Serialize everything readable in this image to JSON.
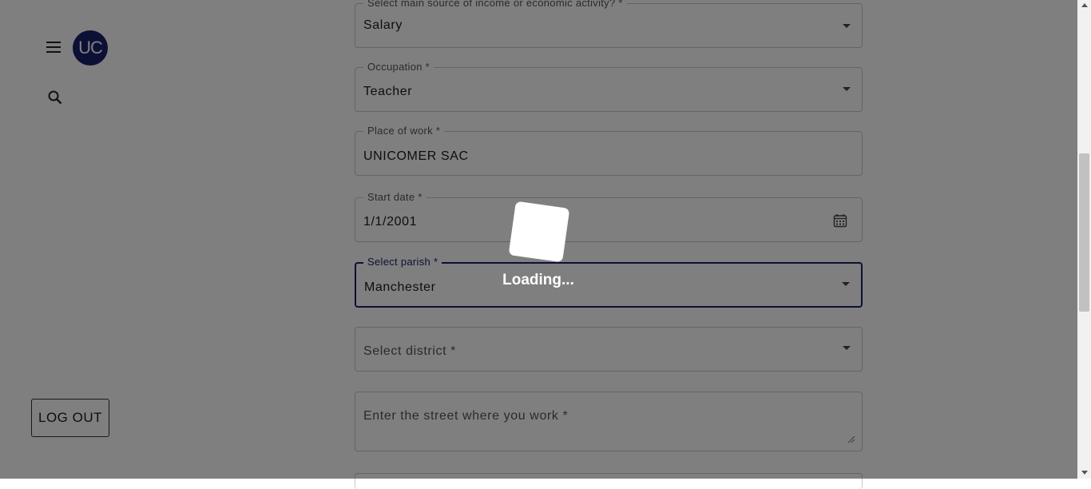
{
  "sidebar": {
    "avatar_initials": "UC",
    "menu_icon": "hamburger-menu-icon",
    "search_icon": "search-icon",
    "logout_label": "LOG OUT"
  },
  "form": {
    "income_source": {
      "label": "Select main source of income or economic activity? *",
      "value": "Salary"
    },
    "occupation": {
      "label": "Occupation *",
      "value": "Teacher"
    },
    "place_of_work": {
      "label": "Place of work *",
      "value": "UNICOMER SAC"
    },
    "start_date": {
      "label": "Start date *",
      "value": "1/1/2001",
      "icon": "calendar-icon"
    },
    "parish": {
      "label": "Select parish *",
      "value": "Manchester"
    },
    "district": {
      "placeholder": "Select district *"
    },
    "street": {
      "placeholder": "Enter the street where you work *"
    }
  },
  "overlay": {
    "loading_text": "Loading..."
  },
  "colors": {
    "primary": "#18206b",
    "overlay": "rgba(0,0,0,0.5)"
  }
}
